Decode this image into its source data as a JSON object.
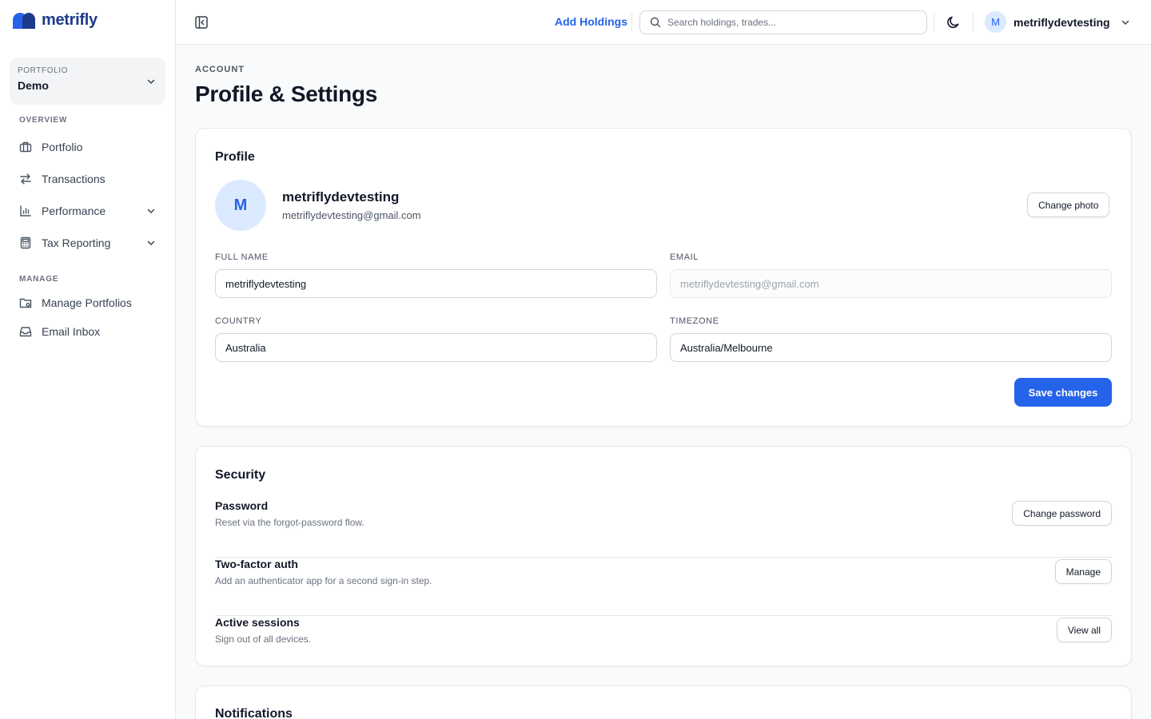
{
  "brand": {
    "name": "metrifly",
    "color": "#2563eb"
  },
  "sidebar": {
    "portfolio": {
      "label": "PORTFOLIO",
      "value": "Demo"
    },
    "sections": {
      "overview": "OVERVIEW",
      "manage": "MANAGE"
    },
    "overview_items": [
      {
        "label": "Portfolio",
        "icon": "briefcase-icon"
      },
      {
        "label": "Transactions",
        "icon": "arrows-swap-icon"
      },
      {
        "label": "Performance",
        "icon": "bar-chart-icon"
      },
      {
        "label": "Tax Reporting",
        "icon": "calculator-icon"
      }
    ],
    "manage_items": [
      {
        "label": "Manage Portfolios",
        "icon": "folder-settings-icon"
      },
      {
        "label": "Email Inbox",
        "icon": "inbox-icon"
      }
    ]
  },
  "topbar": {
    "add_holdings": "Add Holdings",
    "search_placeholder": "Search holdings, trades...",
    "user_initial": "M",
    "user_name": "metriflydevtesting"
  },
  "page": {
    "eyebrow": "ACCOUNT",
    "title": "Profile & Settings"
  },
  "profile": {
    "title": "Profile",
    "avatar_initial": "M",
    "name": "metriflydevtesting",
    "email": "metriflydevtesting@gmail.com",
    "change_photo": "Change photo",
    "fields": {
      "full_name_label": "FULL NAME",
      "full_name": "metriflydevtesting",
      "email_label": "EMAIL",
      "email": "metriflydevtesting@gmail.com",
      "country_label": "COUNTRY",
      "country": "Australia",
      "timezone_label": "TIMEZONE",
      "timezone": "Australia/Melbourne"
    },
    "save": "Save changes"
  },
  "security": {
    "title": "Security",
    "rows": [
      {
        "title": "Password",
        "desc": "Reset via the forgot-password flow.",
        "action": "Change password"
      },
      {
        "title": "Two-factor auth",
        "desc": "Add an authenticator app for a second sign-in step.",
        "action": "Manage"
      },
      {
        "title": "Active sessions",
        "desc": "Sign out of all devices.",
        "action": "View all"
      }
    ]
  },
  "notifications": {
    "title": "Notifications"
  }
}
